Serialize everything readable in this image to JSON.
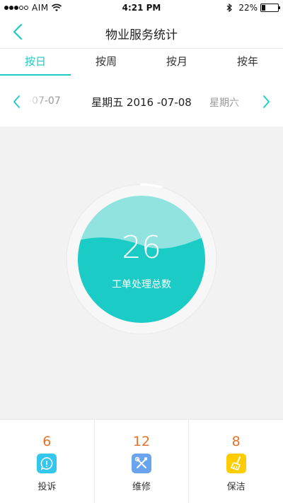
{
  "status_bar": {
    "carrier": "AIM",
    "time": "4:21 PM",
    "battery_percent": "22%",
    "battery_level": 0.22
  },
  "nav": {
    "title": "物业服务统计"
  },
  "tabs": [
    {
      "label": "按日",
      "active": true
    },
    {
      "label": "按周",
      "active": false
    },
    {
      "label": "按月",
      "active": false
    },
    {
      "label": "按年",
      "active": false
    }
  ],
  "date_bar": {
    "prev_date": "-07-07",
    "current": "星期五  2016 -07-08",
    "next_date": "星期六"
  },
  "summary": {
    "total": "26",
    "label": "工单处理总数"
  },
  "stats": [
    {
      "count": "6",
      "label": "投诉",
      "icon": "complaint-icon",
      "color": "#33c7ec"
    },
    {
      "count": "12",
      "label": "维修",
      "icon": "repair-tools-icon",
      "color": "#6aa4ef"
    },
    {
      "count": "8",
      "label": "保洁",
      "icon": "cleaning-broom-icon",
      "color": "#ffcc00"
    }
  ],
  "colors": {
    "accent": "#1bcbc6",
    "count_orange": "#e4722a"
  }
}
